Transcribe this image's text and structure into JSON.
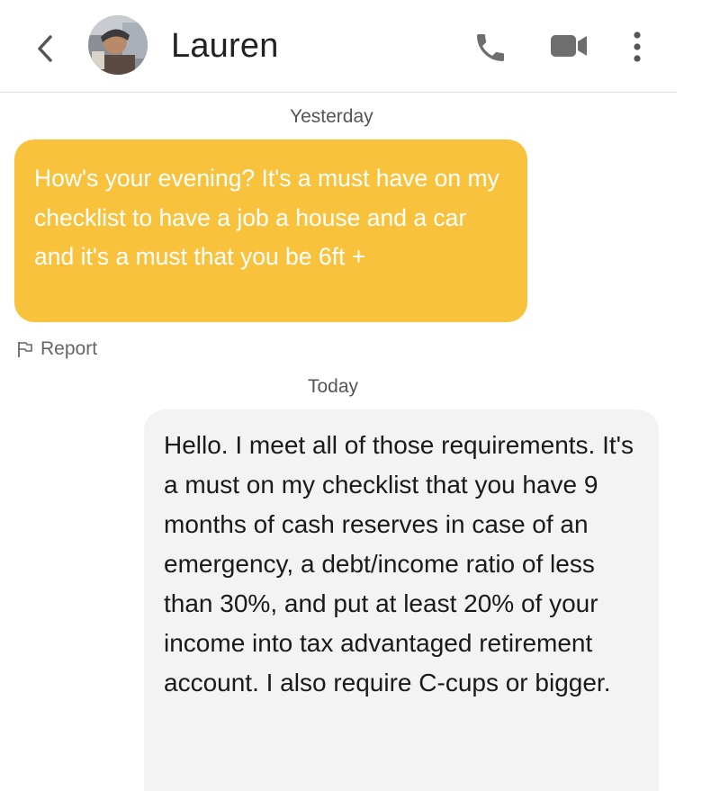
{
  "header": {
    "contact_name": "Lauren",
    "icons": [
      "chevron-left-icon",
      "avatar",
      "phone-icon",
      "video-camera-icon",
      "more-vertical-icon"
    ]
  },
  "conversation": {
    "day_yesterday": "Yesterday",
    "incoming_message": "How's your evening? It's a must have on my checklist to have a job a house and a car and it's a must that you be 6ft +",
    "report_label": "Report",
    "day_today": "Today",
    "outgoing_message": "Hello. I meet all of those requirements. It's a must on my checklist that you have 9 months of cash reserves in case of an emergency, a debt/income ratio of less than 30%, and put at least 20% of your income into tax advantaged retirement account. I also require C-cups or bigger."
  },
  "colors": {
    "incoming_bubble": "#f9c23c",
    "outgoing_bubble": "#f3f3f3",
    "icon_gray": "#6e6e6e"
  }
}
